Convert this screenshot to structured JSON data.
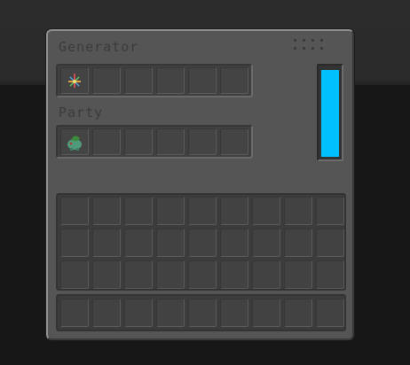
{
  "generator": {
    "title": "Generator",
    "slot_count": 6,
    "items": [
      {
        "slot": 0,
        "icon": "firework-sparkle-icon"
      }
    ]
  },
  "party": {
    "title": "Party",
    "slot_count": 6,
    "items": [
      {
        "slot": 0,
        "icon": "bulbasaur-pokemon-icon"
      }
    ]
  },
  "energy": {
    "level": 1.0,
    "color": "#00bfff"
  },
  "inventory": {
    "rows": 3,
    "columns": 9
  },
  "hotbar": {
    "columns": 9
  },
  "colors": {
    "panel": "#555555",
    "slot": "#444444",
    "label": "#3b3b3b",
    "energy": "#00bfff"
  }
}
